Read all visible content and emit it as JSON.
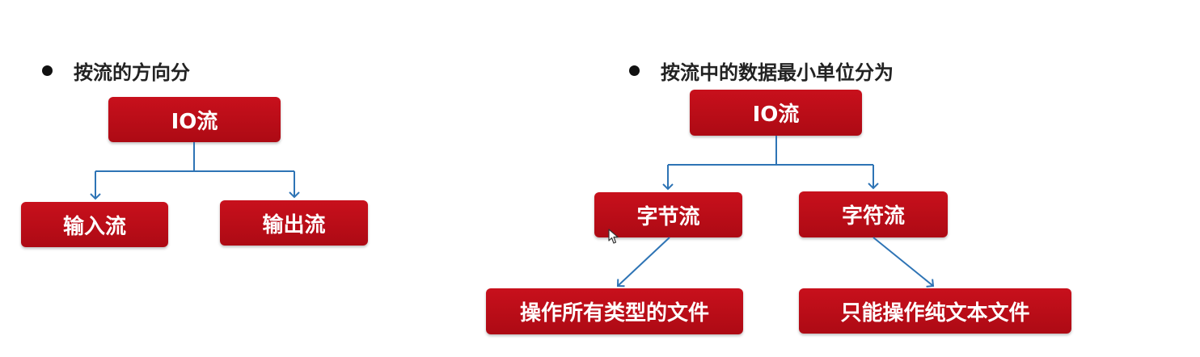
{
  "left_diagram": {
    "heading": "按流的方向分",
    "root": "IO流",
    "children": [
      "输入流",
      "输出流"
    ]
  },
  "right_diagram": {
    "heading": "按流中的数据最小单位分为",
    "root": "IO流",
    "children": [
      "字节流",
      "字符流"
    ],
    "leaves": [
      "操作所有类型的文件",
      "只能操作纯文本文件"
    ]
  },
  "colors": {
    "node_fill": "#c0101c",
    "node_text": "#ffffff",
    "connector": "#2e74b5",
    "heading_text": "#222222"
  }
}
